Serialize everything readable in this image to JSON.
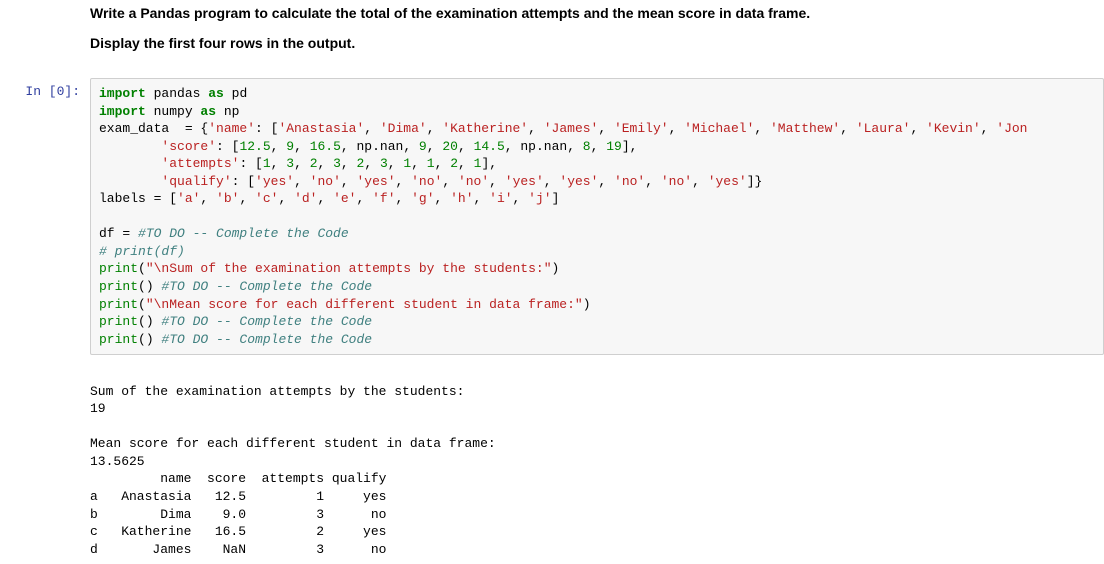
{
  "instructions": {
    "line1": "Write a Pandas program to calculate the total of the examination attempts and the mean score in data frame.",
    "line2": "Display the first four rows in the output."
  },
  "prompt": "In [0]:",
  "code": {
    "l1a": "import",
    "l1b": " pandas ",
    "l1c": "as",
    "l1d": " pd",
    "l2a": "import",
    "l2b": " numpy ",
    "l2c": "as",
    "l2d": " np",
    "l3a": "exam_data  = {",
    "l3b": "'name'",
    "l3c": ": [",
    "l3d": "'Anastasia'",
    "l3e": ", ",
    "l3f": "'Dima'",
    "l3g": ", ",
    "l3h": "'Katherine'",
    "l3i": ", ",
    "l3j": "'James'",
    "l3k": ", ",
    "l3l": "'Emily'",
    "l3m": ", ",
    "l3n": "'Michael'",
    "l3o": ", ",
    "l3p": "'Matthew'",
    "l3q": ", ",
    "l3r": "'Laura'",
    "l3s": ", ",
    "l3t": "'Kevin'",
    "l3u": ", ",
    "l3v": "'Jon",
    "l4a": "        ",
    "l4b": "'score'",
    "l4c": ": [",
    "l4d": "12.5",
    "l4e": ", ",
    "l4f": "9",
    "l4g": ", ",
    "l4h": "16.5",
    "l4i": ", np.nan, ",
    "l4j": "9",
    "l4k": ", ",
    "l4l": "20",
    "l4m": ", ",
    "l4n": "14.5",
    "l4o": ", np.nan, ",
    "l4p": "8",
    "l4q": ", ",
    "l4r": "19",
    "l4s": "],",
    "l5a": "        ",
    "l5b": "'attempts'",
    "l5c": ": [",
    "l5d": "1",
    "l5e": ", ",
    "l5f": "3",
    "l5g": ", ",
    "l5h": "2",
    "l5i": ", ",
    "l5j": "3",
    "l5k": ", ",
    "l5l": "2",
    "l5m": ", ",
    "l5n": "3",
    "l5o": ", ",
    "l5p": "1",
    "l5q": ", ",
    "l5r": "1",
    "l5s": ", ",
    "l5t": "2",
    "l5u": ", ",
    "l5v": "1",
    "l5w": "],",
    "l6a": "        ",
    "l6b": "'qualify'",
    "l6c": ": [",
    "l6d": "'yes'",
    "l6e": ", ",
    "l6f": "'no'",
    "l6g": ", ",
    "l6h": "'yes'",
    "l6i": ", ",
    "l6j": "'no'",
    "l6k": ", ",
    "l6l": "'no'",
    "l6m": ", ",
    "l6n": "'yes'",
    "l6o": ", ",
    "l6p": "'yes'",
    "l6q": ", ",
    "l6r": "'no'",
    "l6s": ", ",
    "l6t": "'no'",
    "l6u": ", ",
    "l6v": "'yes'",
    "l6w": "]}",
    "l7a": "labels = [",
    "l7b": "'a'",
    "l7c": ", ",
    "l7d": "'b'",
    "l7e": ", ",
    "l7f": "'c'",
    "l7g": ", ",
    "l7h": "'d'",
    "l7i": ", ",
    "l7j": "'e'",
    "l7k": ", ",
    "l7l": "'f'",
    "l7m": ", ",
    "l7n": "'g'",
    "l7o": ", ",
    "l7p": "'h'",
    "l7q": ", ",
    "l7r": "'i'",
    "l7s": ", ",
    "l7t": "'j'",
    "l7u": "]",
    "l8": "",
    "l9a": "df = ",
    "l9b": "#TO DO -- Complete the Code",
    "l10": "# print(df)",
    "l11a": "print",
    "l11b": "(",
    "l11c": "\"\\nSum of the examination attempts by the students:\"",
    "l11d": ")",
    "l12a": "print",
    "l12b": "() ",
    "l12c": "#TO DO -- Complete the Code",
    "l13a": "print",
    "l13b": "(",
    "l13c": "\"\\nMean score for each different student in data frame:\"",
    "l13d": ")",
    "l14a": "print",
    "l14b": "() ",
    "l14c": "#TO DO -- Complete the Code",
    "l15a": "print",
    "l15b": "() ",
    "l15c": "#TO DO -- Complete the Code"
  },
  "output": "\nSum of the examination attempts by the students:\n19\n\nMean score for each different student in data frame:\n13.5625\n         name  score  attempts qualify\na   Anastasia   12.5         1     yes\nb        Dima    9.0         3      no\nc   Katherine   16.5         2     yes\nd       James    NaN         3      no"
}
